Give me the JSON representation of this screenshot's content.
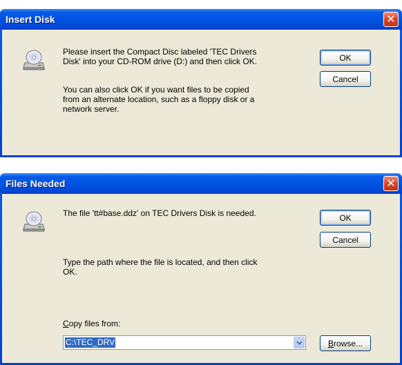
{
  "insert_disk": {
    "title": "Insert Disk",
    "close_symbol": "✕",
    "icon": "cd-drive-icon",
    "message_line1": "Please insert the Compact Disc labeled 'TEC Drivers",
    "message_line2": "Disk' into your CD-ROM drive (D:) and then click OK.",
    "message2_line1": "You can also click OK if you want files to be copied",
    "message2_line2": "from an alternate location, such as a floppy disk or a",
    "message2_line3": "network server.",
    "ok_label": "OK",
    "cancel_label": "Cancel"
  },
  "files_needed": {
    "title": "Files Needed",
    "close_symbol": "✕",
    "icon": "cd-drive-icon",
    "message": "The file 'tt#base.ddz' on TEC Drivers Disk is needed.",
    "path_hint_line1": "Type the path where the file is located, and then click",
    "path_hint_line2": "OK.",
    "copy_from_prefix": "C",
    "copy_from_rest": "opy files from:",
    "copy_from_value": "C:\\TEC_DRV",
    "ok_label": "OK",
    "cancel_label": "Cancel",
    "browse_prefix": "B",
    "browse_rest": "rowse..."
  }
}
